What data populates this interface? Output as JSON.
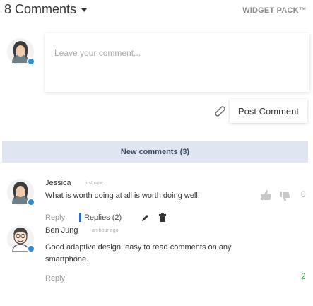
{
  "header": {
    "comments_count_label": "8 Comments",
    "brand_label": "WIDGET PACK™"
  },
  "compose": {
    "placeholder": "Leave your comment...",
    "post_button_label": "Post Comment"
  },
  "new_comments_bar": {
    "label": "New comments (3)"
  },
  "comments": [
    {
      "author": "Jessica",
      "time": "just now",
      "text": "What is worth doing at all is worth doing well.",
      "reply_label": "Reply",
      "replies_label": "Replies (2)",
      "vote_count": "0",
      "vote_color": "#b0b0b0"
    },
    {
      "author": "Ben Jung",
      "time": "an hour ago",
      "text_line1": "Good adaptive design, easy to read comments on any",
      "text_line2": "smartphone.",
      "reply_label": "Reply",
      "vote_count": "2",
      "vote_color": "#3aa646"
    }
  ],
  "colors": {
    "accent_blue": "#2b8fd6",
    "new_bar_bg": "#dfe5f1"
  }
}
